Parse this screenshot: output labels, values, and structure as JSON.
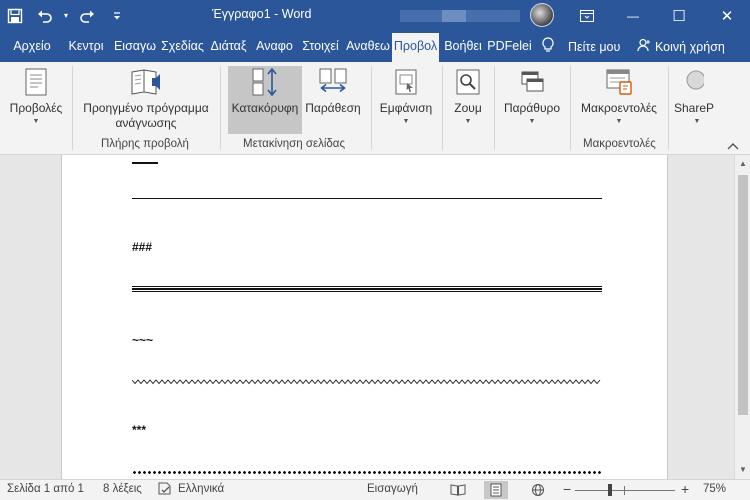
{
  "window": {
    "title": "Έγγραφο1 - Word",
    "controls": {
      "minimize": "—",
      "maximize": "☐",
      "close": "✕"
    }
  },
  "quick_access": [
    "save-icon",
    "undo-icon",
    "redo-icon",
    "customize-qat-icon"
  ],
  "tabs": [
    {
      "label": "Αρχείο",
      "active": false
    },
    {
      "label": "Κεντρι",
      "active": false
    },
    {
      "label": "Εισαγω",
      "active": false
    },
    {
      "label": "Σχεδίας",
      "active": false
    },
    {
      "label": "Διάταξ",
      "active": false
    },
    {
      "label": "Αναφο",
      "active": false
    },
    {
      "label": "Στοιχεί",
      "active": false
    },
    {
      "label": "Αναθεω",
      "active": false
    },
    {
      "label": "Προβολ",
      "active": true
    },
    {
      "label": "Βοήθει",
      "active": false
    },
    {
      "label": "PDFelei",
      "active": false
    }
  ],
  "tell_me": "Πείτε μου",
  "share": "Κοινή χρήση",
  "ribbon": {
    "views": {
      "label": "Προβολές"
    },
    "immersive_reader": {
      "label_line1": "Προηγμένο πρόγραμμα",
      "label_line2": "ανάγνωσης"
    },
    "group_immersive": "Πλήρης προβολή",
    "vertical": {
      "label": "Κατακόρυφη"
    },
    "side_by_side": {
      "label": "Παράθεση"
    },
    "group_page_movement": "Μετακίνηση σελίδας",
    "show": {
      "label": "Εμφάνιση"
    },
    "zoom": {
      "label": "Ζουμ"
    },
    "window": {
      "label": "Παράθυρο"
    },
    "macros": {
      "label": "Μακροεντολές"
    },
    "group_macros": "Μακροεντολές",
    "sharepoint": {
      "label": "ShareP"
    }
  },
  "document": {
    "paragraphs": [
      {
        "text": "###",
        "rule": "triple"
      },
      {
        "text": "~~~",
        "rule": "wavy"
      },
      {
        "text": "***",
        "rule": "dotted"
      }
    ]
  },
  "status": {
    "page": "Σελίδα 1 από 1",
    "words": "8 λέξεις",
    "language": "Ελληνικά",
    "mode": "Εισαγωγή",
    "zoom_minus": "−",
    "zoom_plus": "+",
    "zoom": "75%",
    "zoom_level": 0.75
  },
  "colors": {
    "accent": "#2b579a",
    "ribbon_bg": "#f3f3f3",
    "workspace": "#e6e6e6"
  }
}
